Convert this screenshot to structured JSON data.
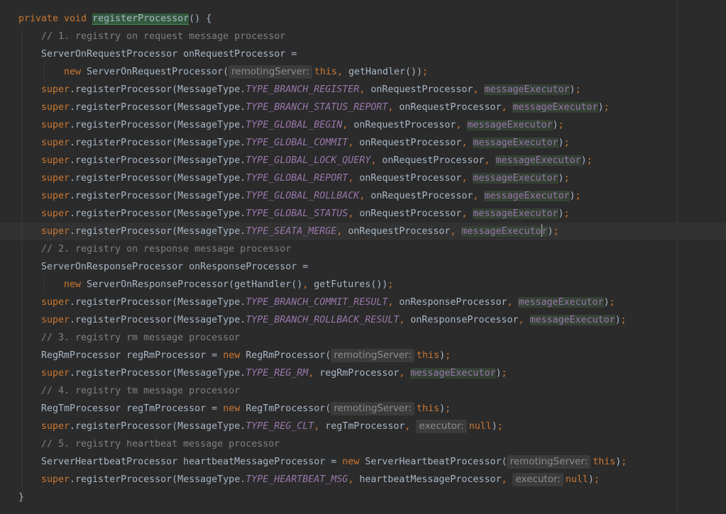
{
  "editor": {
    "colors": {
      "background": "#2b2b2b",
      "keyword": "#cc7832",
      "comment": "#808080",
      "constant": "#9876aa",
      "text": "#a9b7c6",
      "hint_bg": "#3b3b3b"
    },
    "lines": [
      {
        "indent": 0,
        "tokens": [
          {
            "t": "kw",
            "v": "private void "
          },
          {
            "t": "def",
            "v": "registerProcessor"
          },
          {
            "t": "p",
            "v": "() {"
          }
        ]
      },
      {
        "indent": 1,
        "tokens": [
          {
            "t": "cm",
            "v": "// 1. registry on request message processor"
          }
        ]
      },
      {
        "indent": 1,
        "tokens": [
          {
            "t": "p",
            "v": "ServerOnRequestProcessor onRequestProcessor ="
          }
        ]
      },
      {
        "indent": 2,
        "tokens": [
          {
            "t": "kw",
            "v": "new "
          },
          {
            "t": "p",
            "v": "ServerOnRequestProcessor("
          },
          {
            "t": "hint",
            "v": "remotingServer:"
          },
          {
            "t": "kw",
            "v": "this"
          },
          {
            "t": "pn",
            "v": ", "
          },
          {
            "t": "p",
            "v": "getHandler())"
          },
          {
            "t": "pn",
            "v": ";"
          }
        ]
      },
      {
        "indent": 1,
        "tokens": [
          {
            "t": "kw",
            "v": "super"
          },
          {
            "t": "p",
            "v": ".registerProcessor(MessageType."
          },
          {
            "t": "cst",
            "v": "TYPE_BRANCH_REGISTER"
          },
          {
            "t": "pn",
            "v": ", "
          },
          {
            "t": "p",
            "v": "onRequestProcessor"
          },
          {
            "t": "pn",
            "v": ", "
          },
          {
            "t": "exec",
            "v": "messageExecutor"
          },
          {
            "t": "p",
            "v": ")"
          },
          {
            "t": "pn",
            "v": ";"
          }
        ]
      },
      {
        "indent": 1,
        "tokens": [
          {
            "t": "kw",
            "v": "super"
          },
          {
            "t": "p",
            "v": ".registerProcessor(MessageType."
          },
          {
            "t": "cst",
            "v": "TYPE_BRANCH_STATUS_REPORT"
          },
          {
            "t": "pn",
            "v": ", "
          },
          {
            "t": "p",
            "v": "onRequestProcessor"
          },
          {
            "t": "pn",
            "v": ", "
          },
          {
            "t": "exec",
            "v": "messageExecutor"
          },
          {
            "t": "p",
            "v": ")"
          },
          {
            "t": "pn",
            "v": ";"
          }
        ]
      },
      {
        "indent": 1,
        "tokens": [
          {
            "t": "kw",
            "v": "super"
          },
          {
            "t": "p",
            "v": ".registerProcessor(MessageType."
          },
          {
            "t": "cst",
            "v": "TYPE_GLOBAL_BEGIN"
          },
          {
            "t": "pn",
            "v": ", "
          },
          {
            "t": "p",
            "v": "onRequestProcessor"
          },
          {
            "t": "pn",
            "v": ", "
          },
          {
            "t": "exec",
            "v": "messageExecutor"
          },
          {
            "t": "p",
            "v": ")"
          },
          {
            "t": "pn",
            "v": ";"
          }
        ]
      },
      {
        "indent": 1,
        "tokens": [
          {
            "t": "kw",
            "v": "super"
          },
          {
            "t": "p",
            "v": ".registerProcessor(MessageType."
          },
          {
            "t": "cst",
            "v": "TYPE_GLOBAL_COMMIT"
          },
          {
            "t": "pn",
            "v": ", "
          },
          {
            "t": "p",
            "v": "onRequestProcessor"
          },
          {
            "t": "pn",
            "v": ", "
          },
          {
            "t": "exec",
            "v": "messageExecutor"
          },
          {
            "t": "p",
            "v": ")"
          },
          {
            "t": "pn",
            "v": ";"
          }
        ]
      },
      {
        "indent": 1,
        "tokens": [
          {
            "t": "kw",
            "v": "super"
          },
          {
            "t": "p",
            "v": ".registerProcessor(MessageType."
          },
          {
            "t": "cst",
            "v": "TYPE_GLOBAL_LOCK_QUERY"
          },
          {
            "t": "pn",
            "v": ", "
          },
          {
            "t": "p",
            "v": "onRequestProcessor"
          },
          {
            "t": "pn",
            "v": ", "
          },
          {
            "t": "exec",
            "v": "messageExecutor"
          },
          {
            "t": "p",
            "v": ")"
          },
          {
            "t": "pn",
            "v": ";"
          }
        ]
      },
      {
        "indent": 1,
        "tokens": [
          {
            "t": "kw",
            "v": "super"
          },
          {
            "t": "p",
            "v": ".registerProcessor(MessageType."
          },
          {
            "t": "cst",
            "v": "TYPE_GLOBAL_REPORT"
          },
          {
            "t": "pn",
            "v": ", "
          },
          {
            "t": "p",
            "v": "onRequestProcessor"
          },
          {
            "t": "pn",
            "v": ", "
          },
          {
            "t": "exec",
            "v": "messageExecutor"
          },
          {
            "t": "p",
            "v": ")"
          },
          {
            "t": "pn",
            "v": ";"
          }
        ]
      },
      {
        "indent": 1,
        "tokens": [
          {
            "t": "kw",
            "v": "super"
          },
          {
            "t": "p",
            "v": ".registerProcessor(MessageType."
          },
          {
            "t": "cst",
            "v": "TYPE_GLOBAL_ROLLBACK"
          },
          {
            "t": "pn",
            "v": ", "
          },
          {
            "t": "p",
            "v": "onRequestProcessor"
          },
          {
            "t": "pn",
            "v": ", "
          },
          {
            "t": "exec",
            "v": "messageExecutor"
          },
          {
            "t": "p",
            "v": ")"
          },
          {
            "t": "pn",
            "v": ";"
          }
        ]
      },
      {
        "indent": 1,
        "tokens": [
          {
            "t": "kw",
            "v": "super"
          },
          {
            "t": "p",
            "v": ".registerProcessor(MessageType."
          },
          {
            "t": "cst",
            "v": "TYPE_GLOBAL_STATUS"
          },
          {
            "t": "pn",
            "v": ", "
          },
          {
            "t": "p",
            "v": "onRequestProcessor"
          },
          {
            "t": "pn",
            "v": ", "
          },
          {
            "t": "exec",
            "v": "messageExecutor"
          },
          {
            "t": "p",
            "v": ")"
          },
          {
            "t": "pn",
            "v": ";"
          }
        ]
      },
      {
        "indent": 1,
        "current": true,
        "tokens": [
          {
            "t": "kw",
            "v": "super"
          },
          {
            "t": "p",
            "v": ".registerProcessor(MessageType."
          },
          {
            "t": "cst",
            "v": "TYPE_SEATA_MERGE"
          },
          {
            "t": "pn",
            "v": ", "
          },
          {
            "t": "p",
            "v": "onRequestProcessor"
          },
          {
            "t": "pn",
            "v": ", "
          },
          {
            "t": "exec_caret",
            "v": "messageExecutor"
          },
          {
            "t": "p",
            "v": ")"
          },
          {
            "t": "pn",
            "v": ";"
          }
        ]
      },
      {
        "indent": 1,
        "tokens": [
          {
            "t": "cm",
            "v": "// 2. registry on response message processor"
          }
        ]
      },
      {
        "indent": 1,
        "tokens": [
          {
            "t": "p",
            "v": "ServerOnResponseProcessor onResponseProcessor ="
          }
        ]
      },
      {
        "indent": 2,
        "tokens": [
          {
            "t": "kw",
            "v": "new "
          },
          {
            "t": "p",
            "v": "ServerOnResponseProcessor(getHandler()"
          },
          {
            "t": "pn",
            "v": ", "
          },
          {
            "t": "p",
            "v": "getFutures())"
          },
          {
            "t": "pn",
            "v": ";"
          }
        ]
      },
      {
        "indent": 1,
        "tokens": [
          {
            "t": "kw",
            "v": "super"
          },
          {
            "t": "p",
            "v": ".registerProcessor(MessageType."
          },
          {
            "t": "cst",
            "v": "TYPE_BRANCH_COMMIT_RESULT"
          },
          {
            "t": "pn",
            "v": ", "
          },
          {
            "t": "p",
            "v": "onResponseProcessor"
          },
          {
            "t": "pn",
            "v": ", "
          },
          {
            "t": "exec",
            "v": "messageExecutor"
          },
          {
            "t": "p",
            "v": ")"
          },
          {
            "t": "pn",
            "v": ";"
          }
        ]
      },
      {
        "indent": 1,
        "tokens": [
          {
            "t": "kw",
            "v": "super"
          },
          {
            "t": "p",
            "v": ".registerProcessor(MessageType."
          },
          {
            "t": "cst",
            "v": "TYPE_BRANCH_ROLLBACK_RESULT"
          },
          {
            "t": "pn",
            "v": ", "
          },
          {
            "t": "p",
            "v": "onResponseProcessor"
          },
          {
            "t": "pn",
            "v": ", "
          },
          {
            "t": "exec",
            "v": "messageExecutor"
          },
          {
            "t": "p",
            "v": ")"
          },
          {
            "t": "pn",
            "v": ";"
          }
        ]
      },
      {
        "indent": 1,
        "tokens": [
          {
            "t": "cm",
            "v": "// 3. registry rm message processor"
          }
        ]
      },
      {
        "indent": 1,
        "tokens": [
          {
            "t": "p",
            "v": "RegRmProcessor regRmProcessor = "
          },
          {
            "t": "kw",
            "v": "new "
          },
          {
            "t": "p",
            "v": "RegRmProcessor("
          },
          {
            "t": "hint",
            "v": "remotingServer:"
          },
          {
            "t": "kw",
            "v": "this"
          },
          {
            "t": "p",
            "v": ")"
          },
          {
            "t": "pn",
            "v": ";"
          }
        ]
      },
      {
        "indent": 1,
        "tokens": [
          {
            "t": "kw",
            "v": "super"
          },
          {
            "t": "p",
            "v": ".registerProcessor(MessageType."
          },
          {
            "t": "cst",
            "v": "TYPE_REG_RM"
          },
          {
            "t": "pn",
            "v": ", "
          },
          {
            "t": "p",
            "v": "regRmProcessor"
          },
          {
            "t": "pn",
            "v": ", "
          },
          {
            "t": "exec",
            "v": "messageExecutor"
          },
          {
            "t": "p",
            "v": ")"
          },
          {
            "t": "pn",
            "v": ";"
          }
        ]
      },
      {
        "indent": 1,
        "tokens": [
          {
            "t": "cm",
            "v": "// 4. registry tm message processor"
          }
        ]
      },
      {
        "indent": 1,
        "tokens": [
          {
            "t": "p",
            "v": "RegTmProcessor regTmProcessor = "
          },
          {
            "t": "kw",
            "v": "new "
          },
          {
            "t": "p",
            "v": "RegTmProcessor("
          },
          {
            "t": "hint",
            "v": "remotingServer:"
          },
          {
            "t": "kw",
            "v": "this"
          },
          {
            "t": "p",
            "v": ")"
          },
          {
            "t": "pn",
            "v": ";"
          }
        ]
      },
      {
        "indent": 1,
        "tokens": [
          {
            "t": "kw",
            "v": "super"
          },
          {
            "t": "p",
            "v": ".registerProcessor(MessageType."
          },
          {
            "t": "cst",
            "v": "TYPE_REG_CLT"
          },
          {
            "t": "pn",
            "v": ", "
          },
          {
            "t": "p",
            "v": "regTmProcessor"
          },
          {
            "t": "pn",
            "v": ", "
          },
          {
            "t": "hint",
            "v": "executor:"
          },
          {
            "t": "kw",
            "v": "null"
          },
          {
            "t": "p",
            "v": ")"
          },
          {
            "t": "pn",
            "v": ";"
          }
        ]
      },
      {
        "indent": 1,
        "tokens": [
          {
            "t": "cm",
            "v": "// 5. registry heartbeat message processor"
          }
        ]
      },
      {
        "indent": 1,
        "tokens": [
          {
            "t": "p",
            "v": "ServerHeartbeatProcessor heartbeatMessageProcessor = "
          },
          {
            "t": "kw",
            "v": "new "
          },
          {
            "t": "p",
            "v": "ServerHeartbeatProcessor("
          },
          {
            "t": "hint",
            "v": "remotingServer:"
          },
          {
            "t": "kw",
            "v": "this"
          },
          {
            "t": "p",
            "v": ")"
          },
          {
            "t": "pn",
            "v": ";"
          }
        ]
      },
      {
        "indent": 1,
        "tokens": [
          {
            "t": "kw",
            "v": "super"
          },
          {
            "t": "p",
            "v": ".registerProcessor(MessageType."
          },
          {
            "t": "cst",
            "v": "TYPE_HEARTBEAT_MSG"
          },
          {
            "t": "pn",
            "v": ", "
          },
          {
            "t": "p",
            "v": "heartbeatMessageProcessor"
          },
          {
            "t": "pn",
            "v": ", "
          },
          {
            "t": "hint",
            "v": "executor:"
          },
          {
            "t": "kw",
            "v": "null"
          },
          {
            "t": "p",
            "v": ")"
          },
          {
            "t": "pn",
            "v": ";"
          }
        ]
      },
      {
        "indent": 0,
        "tokens": [
          {
            "t": "p",
            "v": "}"
          }
        ]
      }
    ]
  }
}
